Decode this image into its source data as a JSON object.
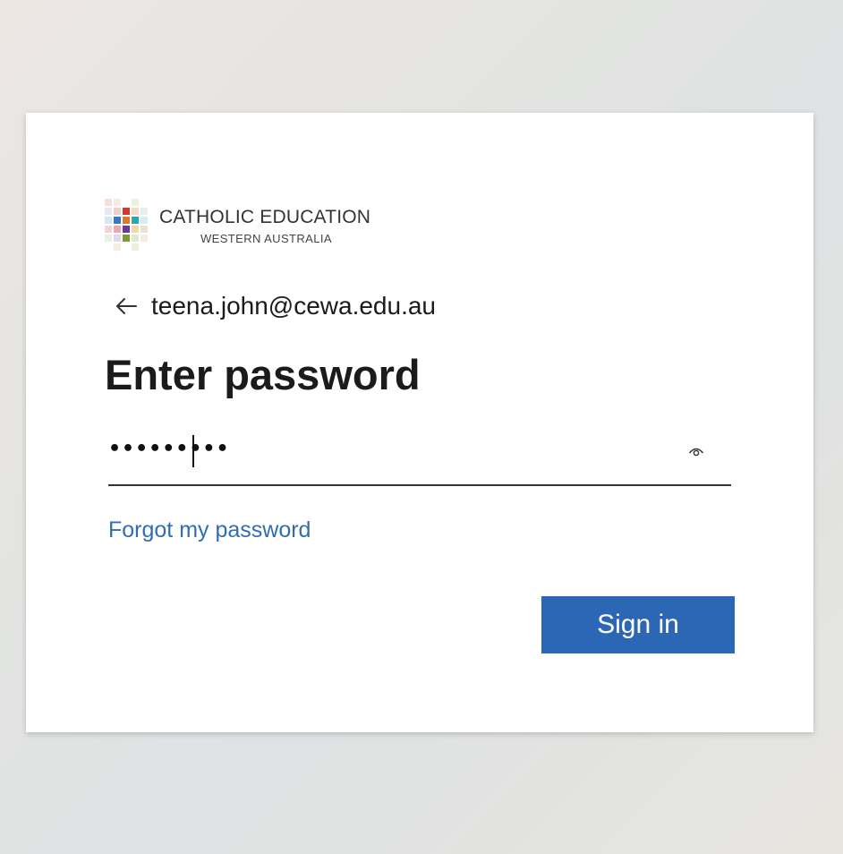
{
  "logo": {
    "title": "CATHOLIC EDUCATION",
    "subtitle": "WESTERN AUSTRALIA"
  },
  "identity": {
    "email": "teena.john@cewa.edu.au",
    "back_icon": "back-arrow-icon"
  },
  "title": "Enter password",
  "password": {
    "masked_value": "•••••••••",
    "reveal_icon": "eye-icon"
  },
  "links": {
    "forgot": "Forgot my password"
  },
  "buttons": {
    "sign_in": "Sign in"
  },
  "colors": {
    "accent": "#2c67b5",
    "link": "#2f6db5",
    "text": "#1b1b1b"
  }
}
